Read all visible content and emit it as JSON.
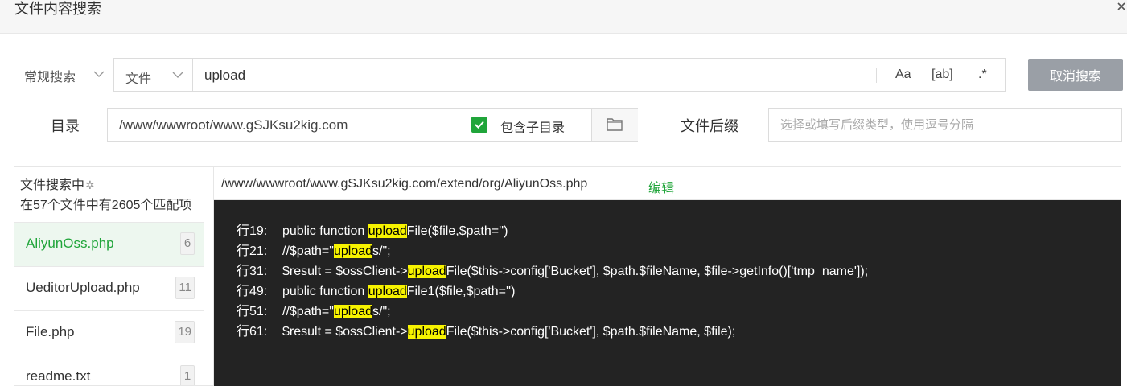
{
  "dialog": {
    "title": "文件内容搜索"
  },
  "search": {
    "mode": "常规搜索",
    "type": "文件",
    "query": "upload",
    "options": {
      "case": "Aa",
      "word": "[ab]",
      "regex": ".*"
    },
    "cancel_label": "取消搜索"
  },
  "directory": {
    "label": "目录",
    "path": "/www/wwwroot/www.gSJKsu2kig.com",
    "include_sub_label": "包含子目录",
    "include_sub_checked": true
  },
  "suffix": {
    "label": "文件后缀",
    "placeholder": "选择或填写后缀类型，使用逗号分隔"
  },
  "results": {
    "status": "文件搜索中",
    "summary": "在57个文件中有2605个匹配项",
    "files": [
      {
        "name": "AliyunOss.php",
        "count": "6",
        "active": true
      },
      {
        "name": "UeditorUpload.php",
        "count": "11",
        "active": false
      },
      {
        "name": "File.php",
        "count": "19",
        "active": false
      },
      {
        "name": "readme.txt",
        "count": "1",
        "active": false
      }
    ]
  },
  "preview": {
    "path": "/www/wwwroot/www.gSJKsu2kig.com/extend/org/AliyunOss.php",
    "edit_label": "编辑",
    "lines": [
      {
        "label": "行19:",
        "segments": [
          {
            "text": "public function ",
            "hl": false
          },
          {
            "text": "upload",
            "hl": true
          },
          {
            "text": "File($file,$path='')",
            "hl": false
          }
        ]
      },
      {
        "label": "行21:",
        "segments": [
          {
            "text": "//$path=\"",
            "hl": false
          },
          {
            "text": "upload",
            "hl": true
          },
          {
            "text": "s/\";",
            "hl": false
          }
        ]
      },
      {
        "label": "行31:",
        "segments": [
          {
            "text": "$result = $ossClient->",
            "hl": false
          },
          {
            "text": "upload",
            "hl": true
          },
          {
            "text": "File($this->config['Bucket'], $path.$fileName, $file->getInfo()['tmp_name']);",
            "hl": false
          }
        ]
      },
      {
        "label": "行49:",
        "segments": [
          {
            "text": "public function ",
            "hl": false
          },
          {
            "text": "upload",
            "hl": true
          },
          {
            "text": "File1($file,$path='')",
            "hl": false
          }
        ]
      },
      {
        "label": "行51:",
        "segments": [
          {
            "text": "//$path=\"",
            "hl": false
          },
          {
            "text": "upload",
            "hl": true
          },
          {
            "text": "s/\";",
            "hl": false
          }
        ]
      },
      {
        "label": "行61:",
        "segments": [
          {
            "text": "$result = $ossClient->",
            "hl": false
          },
          {
            "text": "upload",
            "hl": true
          },
          {
            "text": "File($this->config['Bucket'], $path.$fileName, $file);",
            "hl": false
          }
        ]
      }
    ]
  },
  "colors": {
    "accent": "#20a53a",
    "highlight": "#f7f300",
    "code_bg": "#232323",
    "button_gray": "#9a9fa6"
  },
  "icons": {
    "close": "close-icon",
    "chevron": "chevron-down-icon",
    "check": "checkmark-icon",
    "folder": "folder-icon",
    "spinner": "spinner-icon"
  }
}
